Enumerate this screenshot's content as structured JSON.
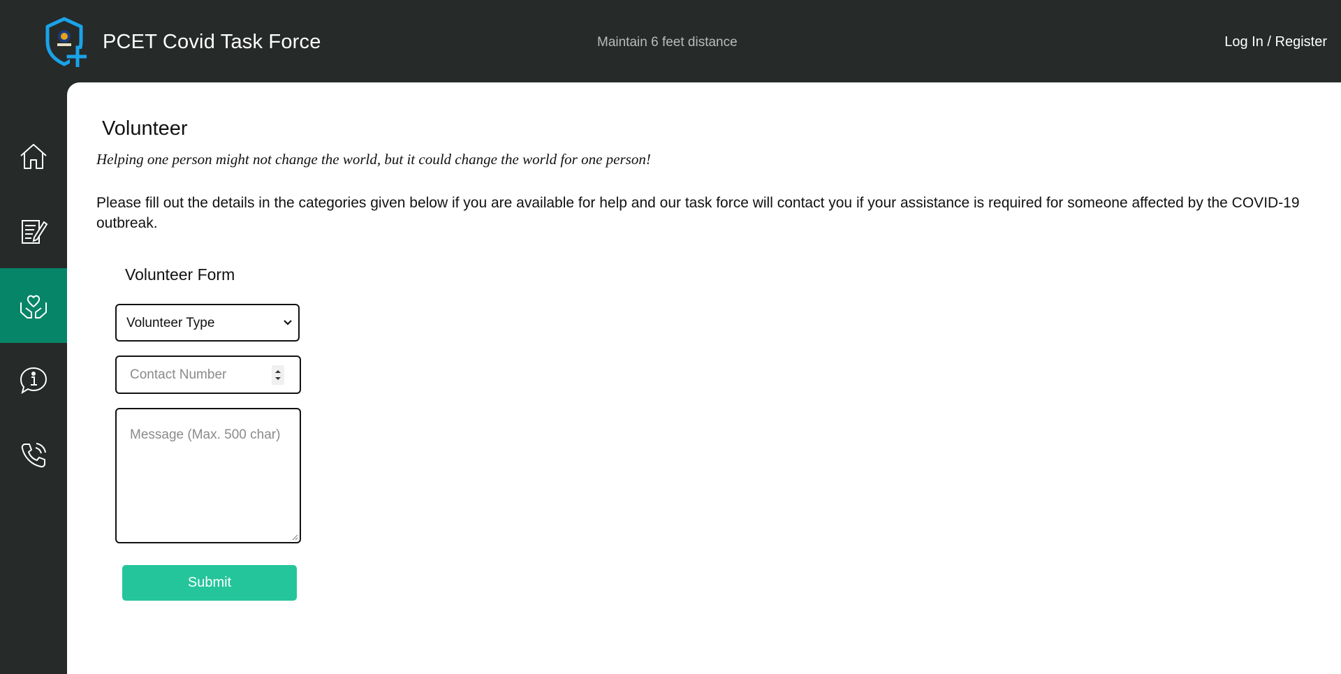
{
  "header": {
    "app_title": "PCET Covid Task Force",
    "tagline": "Maintain 6 feet distance",
    "login_label": "Log In / Register",
    "logo_icon": "shield-plus-icon"
  },
  "sidebar": {
    "items": [
      {
        "icon": "home-icon",
        "active": false
      },
      {
        "icon": "form-edit-icon",
        "active": false
      },
      {
        "icon": "heart-hands-icon",
        "active": true
      },
      {
        "icon": "info-chat-icon",
        "active": false
      },
      {
        "icon": "phone-icon",
        "active": false
      }
    ],
    "active_color": "#078568"
  },
  "main": {
    "title": "Volunteer",
    "quote": "Helping one person might not change the world, but it could change the world for one person!",
    "intro": "Please fill out the details in the categories given below if you are available for help and our task force will contact you if your assistance is required for someone affected by the COVID-19 outbreak.",
    "form": {
      "title": "Volunteer Form",
      "volunteer_type": {
        "selected": "Volunteer Type"
      },
      "contact_placeholder": "Contact Number",
      "message_placeholder": "Message (Max. 500 char)",
      "submit_label": "Submit"
    }
  },
  "colors": {
    "background": "#262a29",
    "accent": "#24c59b",
    "logo_blue": "#1aa3e8"
  }
}
